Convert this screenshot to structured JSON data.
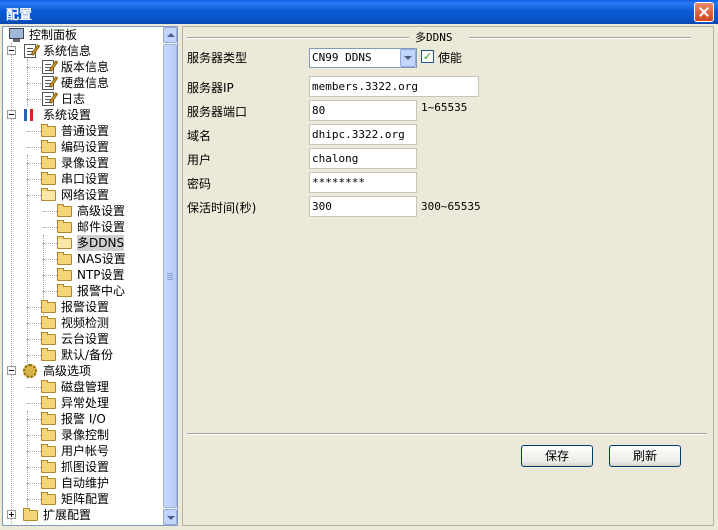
{
  "window": {
    "title": "配置"
  },
  "tree": {
    "items": [
      {
        "label": "控制面板",
        "icon": "computer-icon"
      },
      {
        "label": "系统信息",
        "icon": "document-pencil-icon"
      },
      {
        "label": "版本信息",
        "icon": "document-pencil-icon"
      },
      {
        "label": "硬盘信息",
        "icon": "document-pencil-icon"
      },
      {
        "label": "日志",
        "icon": "document-pencil-icon"
      },
      {
        "label": "系统设置",
        "icon": "tools-icon"
      },
      {
        "label": "普通设置",
        "icon": "folder-icon"
      },
      {
        "label": "编码设置",
        "icon": "folder-icon"
      },
      {
        "label": "录像设置",
        "icon": "folder-icon"
      },
      {
        "label": "串口设置",
        "icon": "folder-icon"
      },
      {
        "label": "网络设置",
        "icon": "folder-open-icon"
      },
      {
        "label": "高级设置",
        "icon": "folder-icon"
      },
      {
        "label": "邮件设置",
        "icon": "folder-icon"
      },
      {
        "label": "多DDNS",
        "icon": "folder-open-icon"
      },
      {
        "label": "NAS设置",
        "icon": "folder-icon"
      },
      {
        "label": "NTP设置",
        "icon": "folder-icon"
      },
      {
        "label": "报警中心",
        "icon": "folder-icon"
      },
      {
        "label": "报警设置",
        "icon": "folder-icon"
      },
      {
        "label": "视频检测",
        "icon": "folder-icon"
      },
      {
        "label": "云台设置",
        "icon": "folder-icon"
      },
      {
        "label": "默认/备份",
        "icon": "folder-icon"
      },
      {
        "label": "高级选项",
        "icon": "gear-icon"
      },
      {
        "label": "磁盘管理",
        "icon": "folder-icon"
      },
      {
        "label": "异常处理",
        "icon": "folder-icon"
      },
      {
        "label": "报警 I/O",
        "icon": "folder-icon"
      },
      {
        "label": "录像控制",
        "icon": "folder-icon"
      },
      {
        "label": "用户帐号",
        "icon": "folder-icon"
      },
      {
        "label": "抓图设置",
        "icon": "folder-icon"
      },
      {
        "label": "自动维护",
        "icon": "folder-icon"
      },
      {
        "label": "矩阵配置",
        "icon": "folder-icon"
      },
      {
        "label": "扩展配置",
        "icon": "folder-icon"
      }
    ],
    "selected": "多DDNS"
  },
  "form": {
    "section_title": "多DDNS",
    "server_type_label": "服务器类型",
    "server_type_value": "CN99 DDNS",
    "enable_label": "使能",
    "enable_checked": "✓",
    "server_ip_label": "服务器IP",
    "server_ip_value": "members.3322.org",
    "server_port_label": "服务器端口",
    "server_port_value": "80",
    "server_port_range": "1~65535",
    "domain_label": "域名",
    "domain_value": "dhipc.3322.org",
    "user_label": "用户",
    "user_value": "chalong",
    "password_label": "密码",
    "password_value": "********",
    "keepalive_label": "保活时间(秒)",
    "keepalive_value": "300",
    "keepalive_range": "300~65535"
  },
  "buttons": {
    "save": "保存",
    "refresh": "刷新"
  }
}
